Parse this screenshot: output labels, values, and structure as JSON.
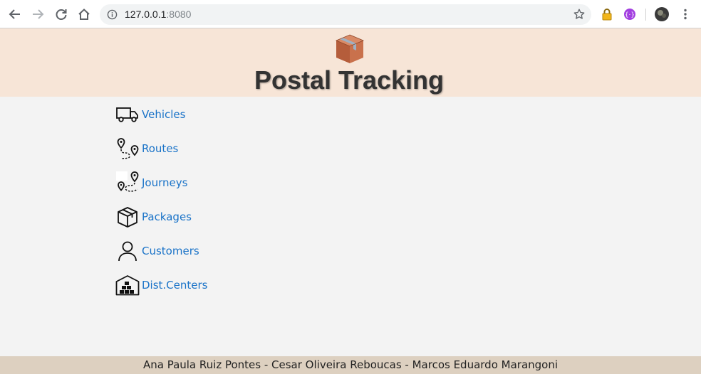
{
  "browser": {
    "url_host": "127.0.0.1",
    "url_port": ":8080",
    "icons": [
      "back-icon",
      "forward-icon",
      "reload-icon",
      "home-icon",
      "info-icon",
      "bookmark-star-icon",
      "lock-extension-icon",
      "extension-icon",
      "profile-avatar",
      "menu-icon"
    ]
  },
  "header": {
    "title": "Postal Tracking",
    "logo_icon": "package-box-icon"
  },
  "nav": {
    "items": [
      {
        "label": "Vehicles",
        "icon": "truck-icon"
      },
      {
        "label": "Routes",
        "icon": "route-pins-icon"
      },
      {
        "label": "Journeys",
        "icon": "journey-pins-icon"
      },
      {
        "label": "Packages",
        "icon": "package-icon"
      },
      {
        "label": "Customers",
        "icon": "user-icon"
      },
      {
        "label": "Dist.Centers",
        "icon": "warehouse-icon"
      }
    ]
  },
  "footer": {
    "text": "Ana Paula Ruiz Pontes - Cesar Oliveira Reboucas - Marcos Eduardo Marangoni"
  },
  "colors": {
    "header_bg": "#f7e5d7",
    "page_bg": "#f3f3f3",
    "footer_bg": "#ddd0c0",
    "link": "#1a73c8"
  }
}
